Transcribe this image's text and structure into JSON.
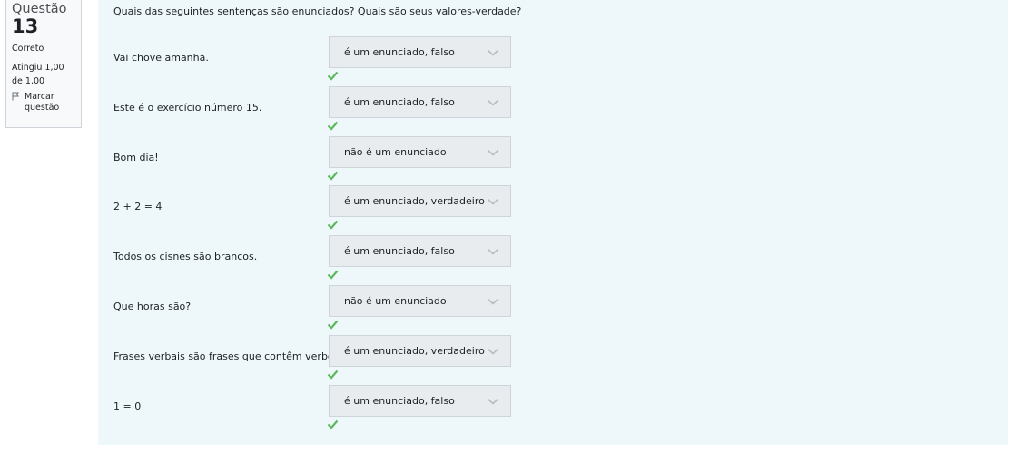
{
  "info": {
    "label": "Questão",
    "number": "13",
    "state": "Correto",
    "grade": "Atingiu 1,00 de 1,00",
    "flag_label": "Marcar questão"
  },
  "question": {
    "text": "Quais das seguintes sentenças são enunciados? Quais são seus valores-verdade?"
  },
  "rows": [
    {
      "statement": "Vai chove amanhã.",
      "answer": "é um enunciado, falso"
    },
    {
      "statement": "Este é o exercício número 15.",
      "answer": "é um enunciado, falso"
    },
    {
      "statement": "Bom dia!",
      "answer": "não é um enunciado"
    },
    {
      "statement": "2 + 2 = 4",
      "answer": "é um enunciado, verdadeiro"
    },
    {
      "statement": "Todos os cisnes são brancos.",
      "answer": "é um enunciado, falso"
    },
    {
      "statement": "Que horas são?",
      "answer": "não é um enunciado"
    },
    {
      "statement": "Frases verbais são frases que contêm verbos.",
      "answer": "é um enunciado, verdadeiro"
    },
    {
      "statement": "1 = 0",
      "answer": "é um enunciado, falso"
    }
  ],
  "colors": {
    "correct": "#5cb85c",
    "content_bg": "#eef7fa",
    "select_bg": "#e9ecef"
  },
  "icons": {
    "chevron": "chevron-down-icon",
    "check": "check-icon",
    "flag": "flag-icon"
  }
}
